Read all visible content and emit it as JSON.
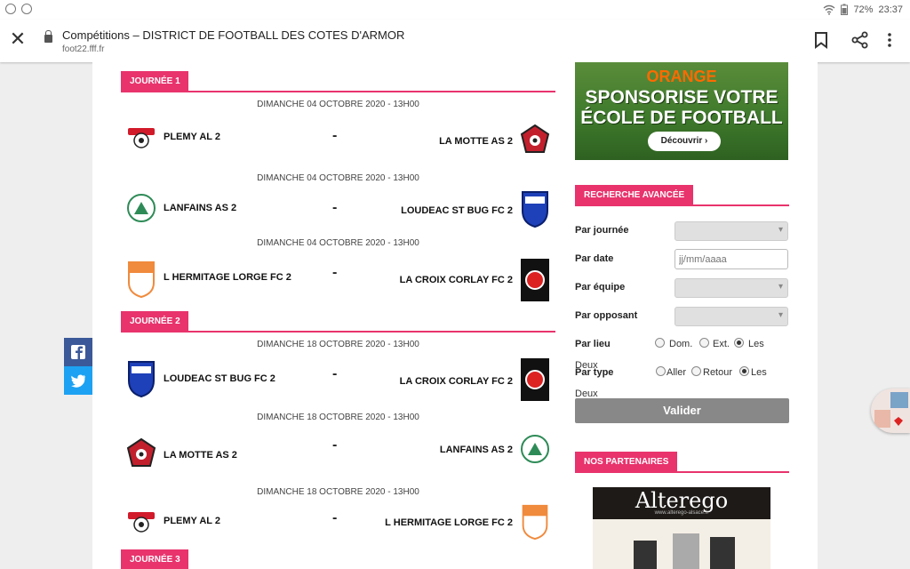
{
  "statusbar": {
    "battery": "72%",
    "time": "23:37"
  },
  "browser": {
    "title": "Compétitions – DISTRICT DE FOOTBALL DES COTES D'ARMOR",
    "url": "foot22.fff.fr"
  },
  "journees": [
    {
      "label": "JOURNÉE 1",
      "matches": [
        {
          "date": "DIMANCHE 04 OCTOBRE 2020 - 13H00",
          "home": "PLEMY AL 2",
          "away": "LA MOTTE AS 2",
          "separator": "-"
        },
        {
          "date": "DIMANCHE 04 OCTOBRE 2020 - 13H00",
          "home": "LANFAINS AS 2",
          "away": "LOUDEAC ST BUG FC 2",
          "separator": "-"
        },
        {
          "date": "DIMANCHE 04 OCTOBRE 2020 - 13H00",
          "home": "L HERMITAGE LORGE FC 2",
          "away": "LA CROIX CORLAY FC 2",
          "separator": "-"
        }
      ]
    },
    {
      "label": "JOURNÉE 2",
      "matches": [
        {
          "date": "DIMANCHE 18 OCTOBRE 2020 - 13H00",
          "home": "LOUDEAC ST BUG FC 2",
          "away": "LA CROIX CORLAY FC 2",
          "separator": "-"
        },
        {
          "date": "DIMANCHE 18 OCTOBRE 2020 - 13H00",
          "home": "LA MOTTE AS 2",
          "away": "LANFAINS AS 2",
          "separator": "-"
        },
        {
          "date": "DIMANCHE 18 OCTOBRE 2020 - 13H00",
          "home": "PLEMY AL 2",
          "away": "L HERMITAGE LORGE FC 2",
          "separator": "-"
        }
      ]
    },
    {
      "label": "JOURNÉE 3",
      "matches": []
    }
  ],
  "ad": {
    "line1": "ORANGE",
    "line2": "SPONSORISE VOTRE",
    "line3": "ÉCOLE DE FOOTBALL",
    "button": "Découvrir"
  },
  "search": {
    "heading": "RECHERCHE AVANCÉE",
    "par_journee": "Par journée",
    "par_date": "Par date",
    "date_placeholder": "jj/mm/aaaa",
    "par_equipe": "Par équipe",
    "par_opposant": "Par opposant",
    "par_lieu": "Par lieu",
    "lieu_options": [
      "Dom.",
      "Ext.",
      "Les",
      "Deux"
    ],
    "par_type": "Par type",
    "type_options": [
      "Aller",
      "Retour",
      "Les",
      "Deux"
    ],
    "submit": "Valider"
  },
  "partners": {
    "heading": "NOS PARTENAIRES",
    "brand": "Alterego",
    "brand_sub": "www.alterego-alsace.fr"
  },
  "colors": {
    "accent": "#e8336d",
    "facebook": "#3b5998",
    "twitter": "#1da1f2",
    "button": "#888888"
  }
}
